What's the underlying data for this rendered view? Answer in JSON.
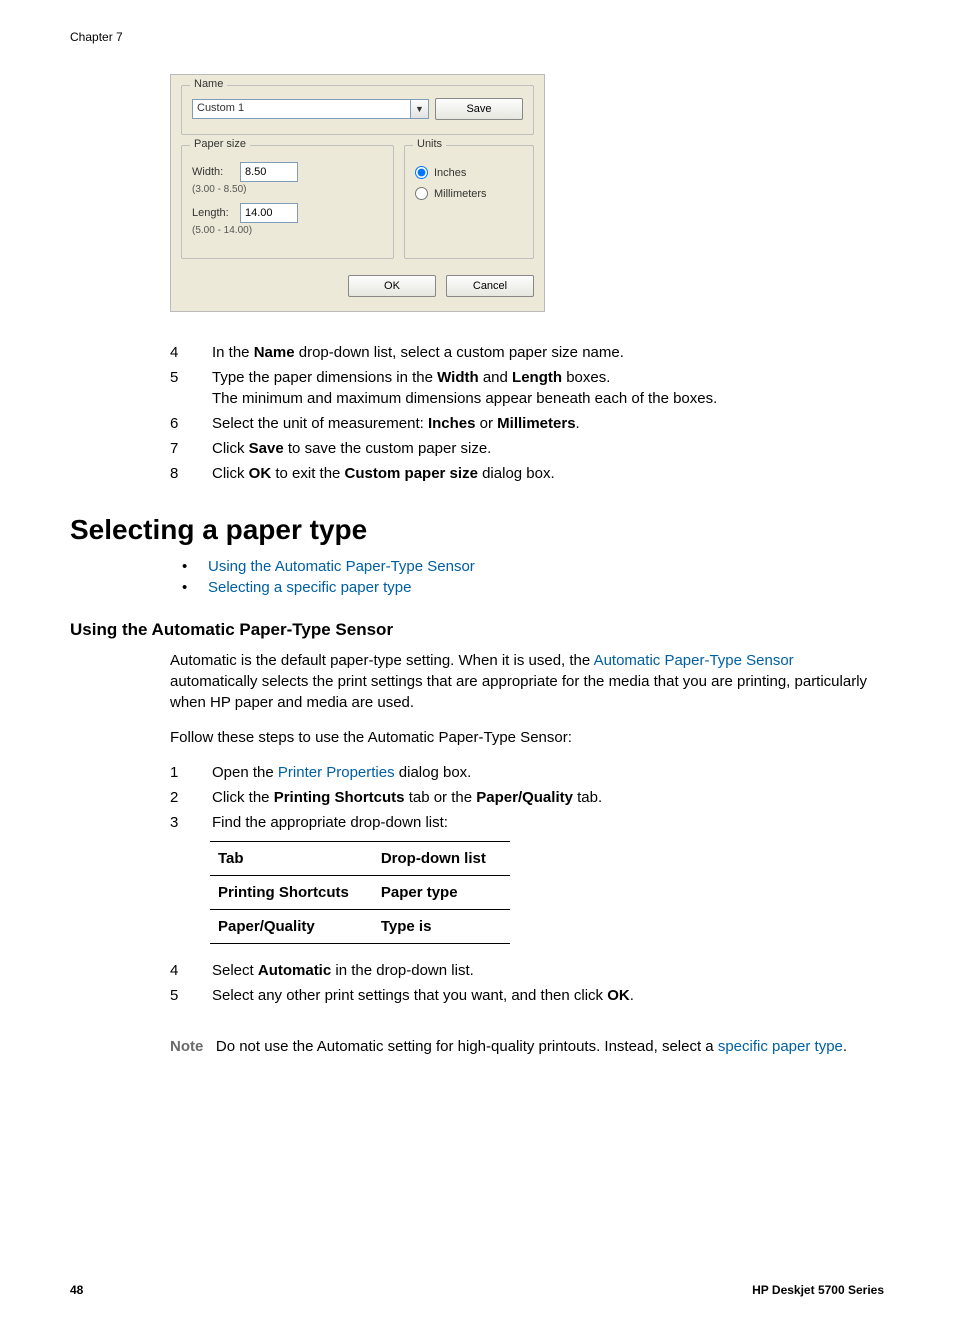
{
  "chapter_label": "Chapter 7",
  "dialog": {
    "name_legend": "Name",
    "name_value": "Custom 1",
    "save_label": "Save",
    "paper_legend": "Paper size",
    "width_label": "Width:",
    "width_value": "8.50",
    "width_hint": "(3.00 - 8.50)",
    "length_label": "Length:",
    "length_value": "14.00",
    "length_hint": "(5.00 - 14.00)",
    "units_legend": "Units",
    "units_inches": "Inches",
    "units_mm": "Millimeters",
    "ok_label": "OK",
    "cancel_label": "Cancel",
    "dropdown_glyph": "▼"
  },
  "steps_a": {
    "s4a": "In the ",
    "s4b": "Name",
    "s4c": " drop-down list, select a custom paper size name.",
    "s5a": "Type the paper dimensions in the ",
    "s5b": "Width",
    "s5c": " and ",
    "s5d": "Length",
    "s5e": " boxes.",
    "s5f": "The minimum and maximum dimensions appear beneath each of the boxes.",
    "s6a": "Select the unit of measurement: ",
    "s6b": "Inches",
    "s6c": " or ",
    "s6d": "Millimeters",
    "s6e": ".",
    "s7a": "Click ",
    "s7b": "Save",
    "s7c": " to save the custom paper size.",
    "s8a": "Click ",
    "s8b": "OK",
    "s8c": " to exit the ",
    "s8d": "Custom paper size",
    "s8e": " dialog box."
  },
  "heading_select": "Selecting a paper type",
  "bullets": {
    "b1": "Using the Automatic Paper-Type Sensor",
    "b2": "Selecting a specific paper type"
  },
  "subhead_auto": "Using the Automatic Paper-Type Sensor",
  "para1a": "Automatic is the default paper-type setting. When it is used, the ",
  "para1link": "Automatic Paper-Type Sensor",
  "para1b": " automatically selects the print settings that are appropriate for the media that you are printing, particularly when HP paper and media are used.",
  "para2": "Follow these steps to use the Automatic Paper-Type Sensor:",
  "steps_b": {
    "s1a": "Open the ",
    "s1link": "Printer Properties",
    "s1b": " dialog box.",
    "s2a": "Click the ",
    "s2b": "Printing Shortcuts",
    "s2c": " tab or the ",
    "s2d": "Paper/Quality",
    "s2e": " tab.",
    "s3": "Find the appropriate drop-down list:"
  },
  "table": {
    "h1": "Tab",
    "h2": "Drop-down list",
    "r1c1": "Printing Shortcuts",
    "r1c2": "Paper type",
    "r2c1": "Paper/Quality",
    "r2c2": "Type is"
  },
  "steps_c": {
    "s4a": "Select ",
    "s4b": "Automatic",
    "s4c": " in the drop-down list.",
    "s5a": "Select any other print settings that you want, and then click ",
    "s5b": "OK",
    "s5c": "."
  },
  "note": {
    "label": "Note",
    "body_a": "Do not use the Automatic setting for high-quality printouts. Instead, select a ",
    "link": "specific paper type",
    "body_b": "."
  },
  "footer": {
    "page": "48",
    "series": "HP Deskjet 5700 Series"
  }
}
